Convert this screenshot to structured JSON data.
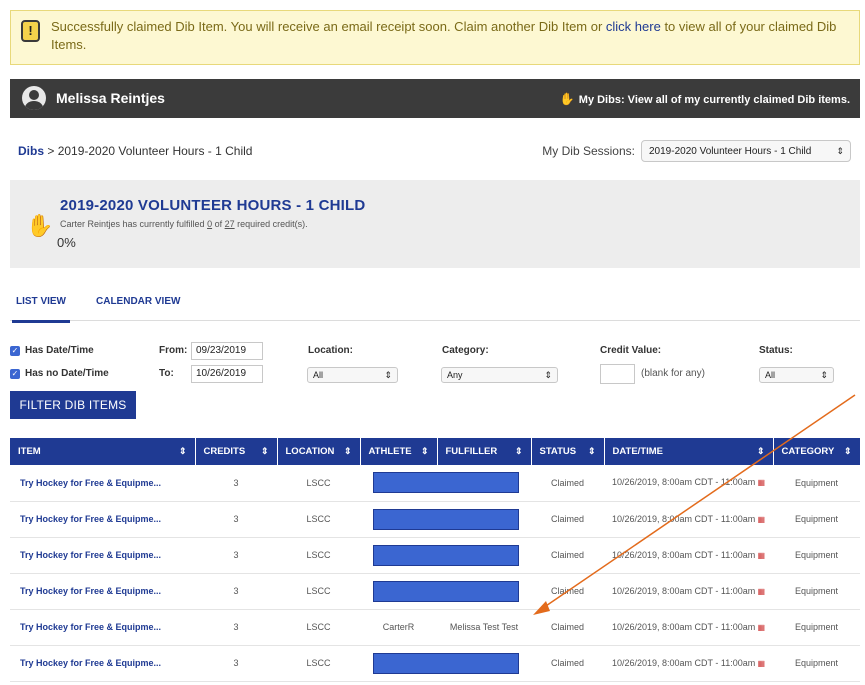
{
  "alert": {
    "text_before": "Successfully claimed Dib Item. You will receive an email receipt soon. Claim another Dib Item or ",
    "link": "click here",
    "text_after": " to view all of your claimed Dib Items.",
    "icon": "exclamation-icon"
  },
  "user": {
    "name": "Melissa Reintjes",
    "my_dibs": "My Dibs: View all of my currently claimed Dib items."
  },
  "breadcrumb": {
    "root": "Dibs",
    "current": " > 2019-2020 Volunteer Hours - 1 Child"
  },
  "sessions": {
    "label": "My Dib Sessions:",
    "selected": "2019-2020 Volunteer Hours - 1 Child"
  },
  "info": {
    "title": "2019-2020 VOLUNTEER HOURS - 1 CHILD",
    "sub_before": "Carter Reintjes has currently fulfilled ",
    "fulfilled": "0",
    "sub_mid": " of ",
    "required": "27",
    "sub_after": " required credit(s).",
    "percent": "0%"
  },
  "tabs": [
    "LIST VIEW",
    "CALENDAR VIEW"
  ],
  "filters": {
    "has_date": "Has Date/Time",
    "no_date": "Has no Date/Time",
    "from_label": "From:",
    "from_value": "09/23/2019",
    "to_label": "To:",
    "to_value": "10/26/2019",
    "location_label": "Location:",
    "location_value": "All",
    "category_label": "Category:",
    "category_value": "Any",
    "credit_label": "Credit Value:",
    "credit_hint": "(blank for any)",
    "status_label": "Status:",
    "status_value": "All",
    "button": "FILTER DIB ITEMS"
  },
  "table": {
    "headers": [
      "ITEM",
      "CREDITS",
      "LOCATION",
      "ATHLETE",
      "FULFILLER",
      "STATUS",
      "DATE/TIME",
      "CATEGORY"
    ],
    "rows": [
      {
        "item": "Try Hockey for Free & Equipme...",
        "credits": "3",
        "location": "LSCC",
        "athlete": "",
        "fulfiller": "",
        "status": "Claimed",
        "datetime": "10/26/2019, 8:00am CDT - 11:00am",
        "category": "Equipment",
        "redacted": true
      },
      {
        "item": "Try Hockey for Free & Equipme...",
        "credits": "3",
        "location": "LSCC",
        "athlete": "",
        "fulfiller": "",
        "status": "Claimed",
        "datetime": "10/26/2019, 8:00am CDT - 11:00am",
        "category": "Equipment",
        "redacted": true
      },
      {
        "item": "Try Hockey for Free & Equipme...",
        "credits": "3",
        "location": "LSCC",
        "athlete": "",
        "fulfiller": "",
        "status": "Claimed",
        "datetime": "10/26/2019, 8:00am CDT - 11:00am",
        "category": "Equipment",
        "redacted": true
      },
      {
        "item": "Try Hockey for Free & Equipme...",
        "credits": "3",
        "location": "LSCC",
        "athlete": "",
        "fulfiller": "",
        "status": "Claimed",
        "datetime": "10/26/2019, 8:00am CDT - 11:00am",
        "category": "Equipment",
        "redacted": true
      },
      {
        "item": "Try Hockey for Free & Equipme...",
        "credits": "3",
        "location": "LSCC",
        "athlete": "CarterR",
        "fulfiller": "Melissa Test Test",
        "status": "Claimed",
        "datetime": "10/26/2019, 8:00am CDT - 11:00am",
        "category": "Equipment",
        "redacted": false
      },
      {
        "item": "Try Hockey for Free & Equipme...",
        "credits": "3",
        "location": "LSCC",
        "athlete": "",
        "fulfiller": "",
        "status": "Claimed",
        "datetime": "10/26/2019, 8:00am CDT - 11:00am",
        "category": "Equipment",
        "redacted": true
      }
    ]
  },
  "colors": {
    "brand": "#1f3a93",
    "alert_bg": "#fdf8d2",
    "userbar": "#3b3b3b",
    "redaction": "#3b66d1",
    "annotation_arrow": "#e36b1c"
  }
}
